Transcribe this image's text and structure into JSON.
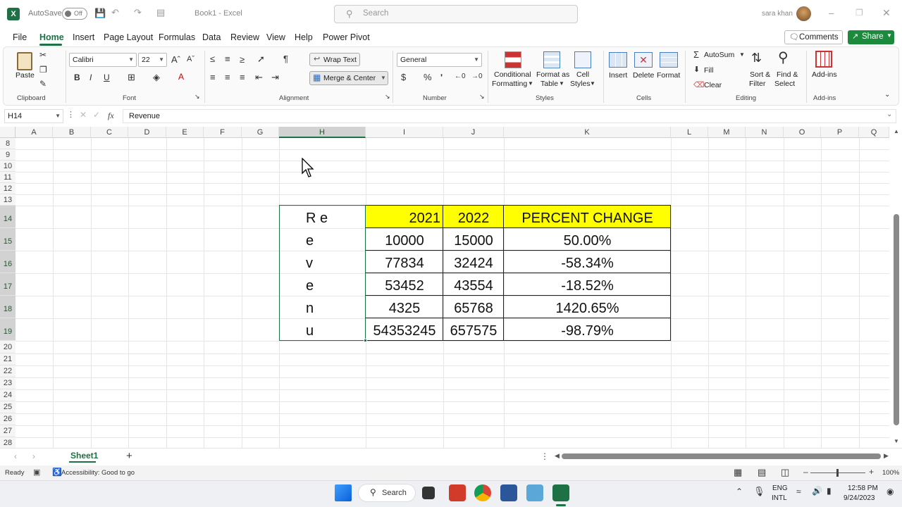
{
  "titlebar": {
    "autosave_label": "AutoSave",
    "autosave_state": "Off",
    "document_title": "Book1 - Excel",
    "search_placeholder": "Search",
    "user_name": "sara khan"
  },
  "menu": {
    "items": [
      "File",
      "Home",
      "Insert",
      "Page Layout",
      "Formulas",
      "Data",
      "Review",
      "View",
      "Help",
      "Power Pivot"
    ],
    "active": "Home",
    "comments_label": "Comments",
    "share_label": "Share"
  },
  "ribbon": {
    "clipboard": {
      "paste_label": "Paste",
      "group_label": "Clipboard"
    },
    "font": {
      "font_name": "Calibri",
      "font_size": "22",
      "group_label": "Font"
    },
    "alignment": {
      "wrap_text_label": "Wrap Text",
      "merge_center_label": "Merge & Center",
      "group_label": "Alignment"
    },
    "number": {
      "format": "General",
      "group_label": "Number"
    },
    "styles": {
      "conditional_line1": "Conditional",
      "conditional_line2": "Formatting",
      "format_table_line1": "Format as",
      "format_table_line2": "Table",
      "cell_styles_line1": "Cell",
      "cell_styles_line2": "Styles",
      "group_label": "Styles"
    },
    "cells": {
      "insert_label": "Insert",
      "delete_label": "Delete",
      "format_label": "Format",
      "group_label": "Cells"
    },
    "editing": {
      "autosum_label": "AutoSum",
      "fill_label": "Fill",
      "clear_label": "Clear",
      "sort_line1": "Sort &",
      "sort_line2": "Filter",
      "find_line1": "Find &",
      "find_line2": "Select",
      "group_label": "Editing"
    },
    "addins": {
      "label": "Add-ins",
      "group_label": "Add-ins"
    }
  },
  "formula_bar": {
    "name_box": "H14",
    "fx_label": "fx",
    "content": "Revenue"
  },
  "columns": [
    "A",
    "B",
    "C",
    "D",
    "E",
    "F",
    "G",
    "H",
    "I",
    "J",
    "K",
    "L",
    "M",
    "N",
    "O",
    "P",
    "Q"
  ],
  "rows": [
    "8",
    "9",
    "10",
    "11",
    "12",
    "13",
    "14",
    "15",
    "16",
    "17",
    "18",
    "19",
    "20",
    "21",
    "22",
    "23",
    "24",
    "25",
    "26",
    "27",
    "28"
  ],
  "table": {
    "header": {
      "h": "R   e",
      "i": "2021",
      "j": "2022",
      "k": "PERCENT CHANGE"
    },
    "h_letters": [
      "e",
      "v",
      "e",
      "n",
      "u"
    ],
    "rows": [
      {
        "y2021": "10000",
        "y2022": "15000",
        "change": "50.00%"
      },
      {
        "y2021": "77834",
        "y2022": "32424",
        "change": "-58.34%"
      },
      {
        "y2021": "53452",
        "y2022": "43554",
        "change": "-18.52%"
      },
      {
        "y2021": "4325",
        "y2022": "65768",
        "change": "1420.65%"
      },
      {
        "y2021": "54353245",
        "y2022": "657575",
        "change": "-98.79%"
      }
    ],
    "header_fill": "#ffff00"
  },
  "sheets": {
    "tabs": [
      "Sheet1"
    ],
    "active": "Sheet1"
  },
  "status": {
    "ready": "Ready",
    "accessibility": "Accessibility: Good to go",
    "zoom": "100%"
  },
  "taskbar": {
    "search_label": "Search",
    "lang_line1": "ENG",
    "lang_line2": "INTL",
    "time": "12:58 PM",
    "date": "9/24/2023"
  },
  "colors": {
    "excel_green": "#1e7145",
    "share_green": "#1b8a3c",
    "selection": "#217346"
  }
}
